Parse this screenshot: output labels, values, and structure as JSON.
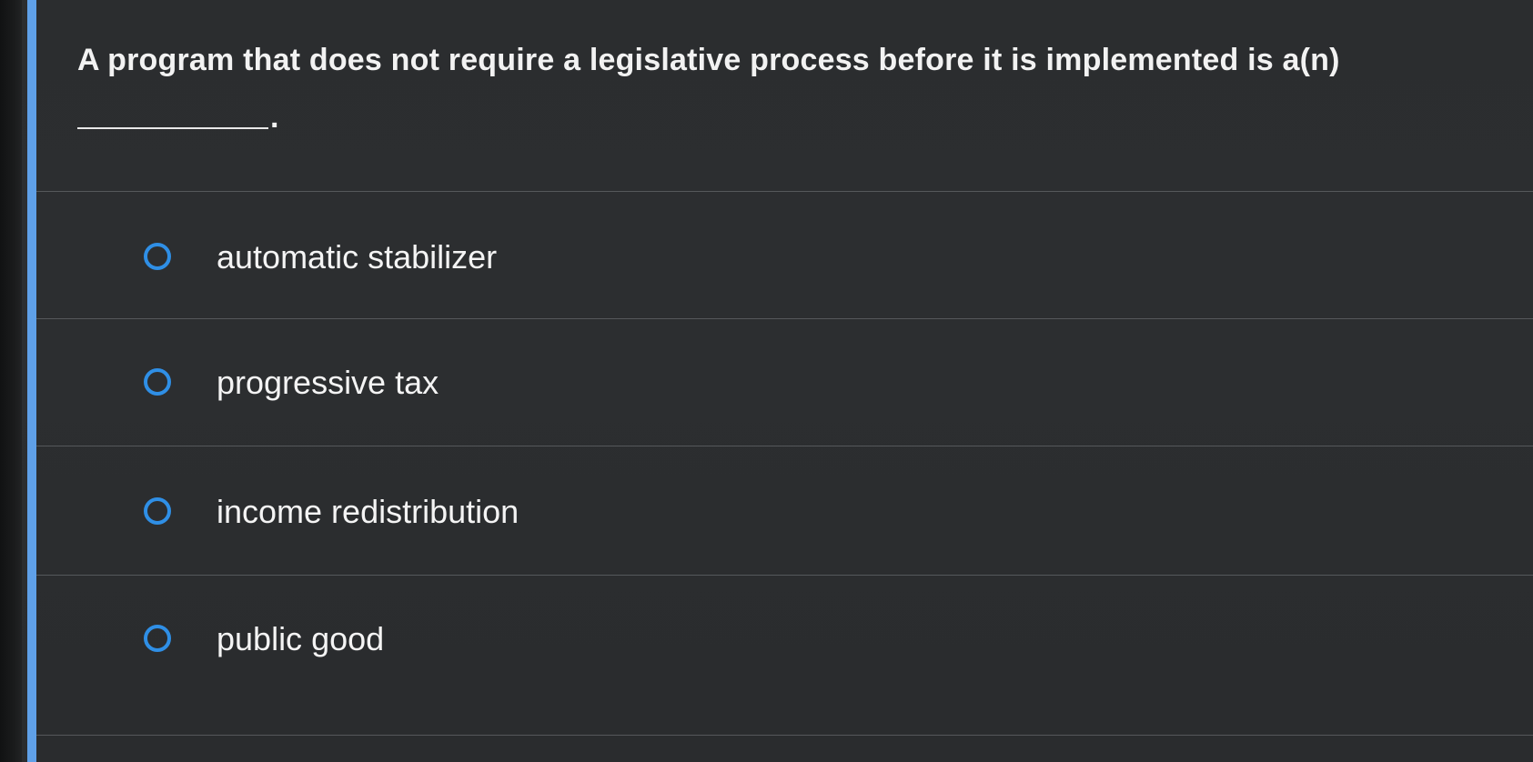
{
  "question": {
    "text": "A program that does not require a legislative process before it is implemented is a(n)",
    "blank_period": "."
  },
  "options": [
    {
      "label": "automatic stabilizer",
      "selected": false
    },
    {
      "label": "progressive tax",
      "selected": false
    },
    {
      "label": "income redistribution",
      "selected": false
    },
    {
      "label": "public good",
      "selected": false
    }
  ],
  "colors": {
    "radio_accent": "#2f8fe6",
    "left_accent_bar": "#5fa0e8",
    "background": "#2b2d2f"
  }
}
